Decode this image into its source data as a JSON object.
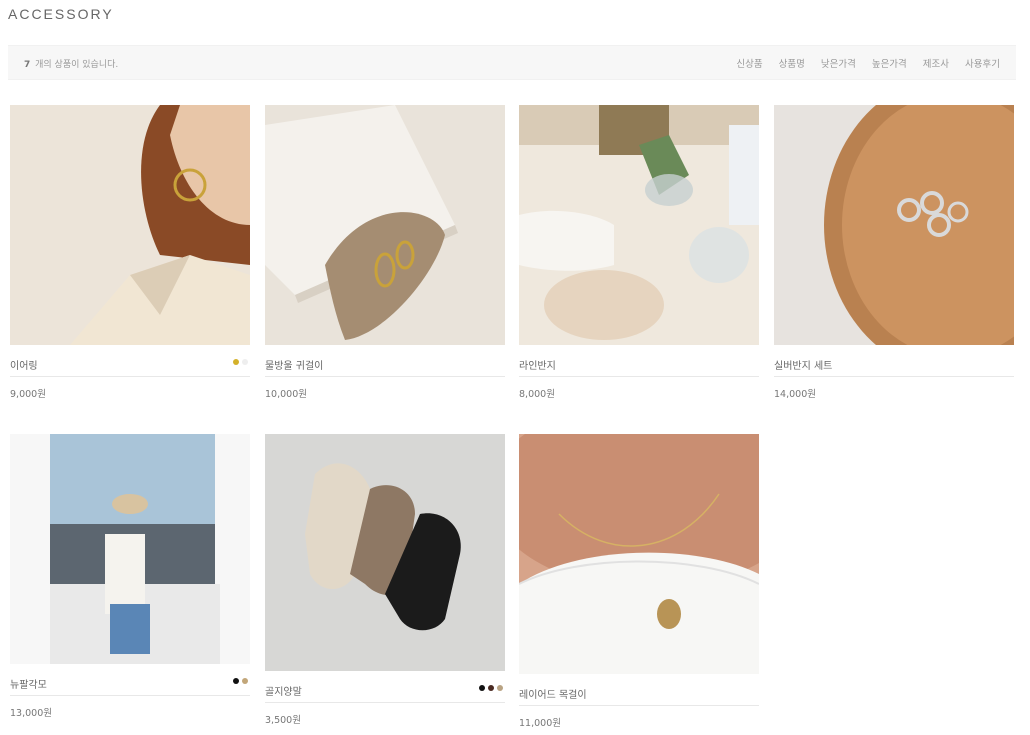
{
  "page": {
    "title": "ACCESSORY"
  },
  "toolbar": {
    "count_number": "7",
    "count_text": "개의 상품이 있습니다.",
    "sort_options": [
      "신상품",
      "상품명",
      "낮은가격",
      "높은가격",
      "제조사",
      "사용후기"
    ]
  },
  "products": [
    {
      "name": "이어링",
      "price": "9,000원",
      "swatches": [
        "#d4b12a",
        "#eeeeee"
      ]
    },
    {
      "name": "물방울 귀걸이",
      "price": "10,000원",
      "swatches": []
    },
    {
      "name": "라인반지",
      "price": "8,000원",
      "swatches": []
    },
    {
      "name": "실버반지 세트",
      "price": "14,000원",
      "swatches": []
    },
    {
      "name": "뉴팔각모",
      "price": "13,000원",
      "swatches": [
        "#111111",
        "#c2a679"
      ]
    },
    {
      "name": "골지양말",
      "price": "3,500원",
      "swatches": [
        "#111111",
        "#4a2a22",
        "#b9a383"
      ]
    },
    {
      "name": "레이어드 목걸이",
      "price": "11,000원",
      "swatches": []
    }
  ]
}
